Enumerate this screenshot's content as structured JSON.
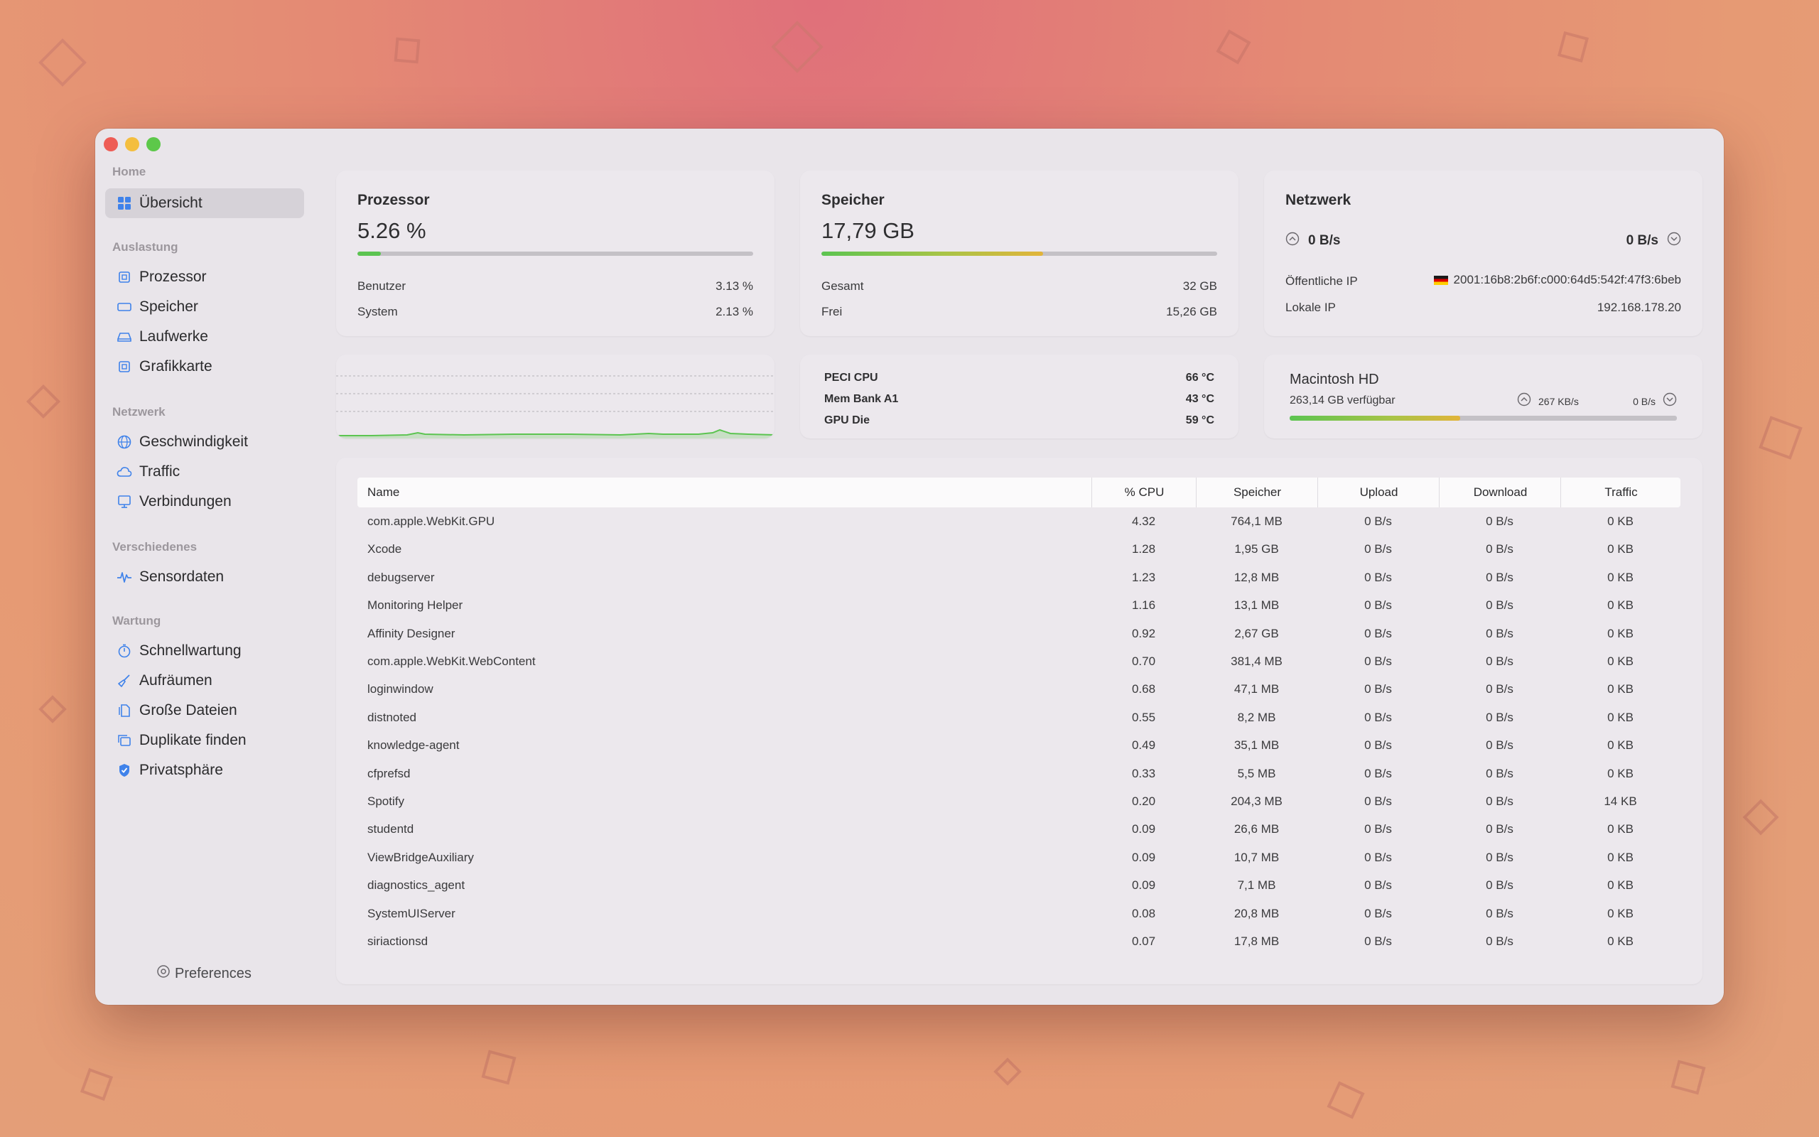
{
  "colors": {
    "accent": "#3f82ea",
    "bar_green": "#5cc451",
    "chart_line": "#5cc451"
  },
  "sidebar": {
    "sections": [
      {
        "title": "Home"
      },
      {
        "title": "Auslastung"
      },
      {
        "title": "Netzwerk"
      },
      {
        "title": "Verschiedenes"
      },
      {
        "title": "Wartung"
      }
    ],
    "items": [
      {
        "label": "Übersicht",
        "icon": "grid-icon"
      },
      {
        "label": "Prozessor",
        "icon": "cpu-icon"
      },
      {
        "label": "Speicher",
        "icon": "memory-icon"
      },
      {
        "label": "Laufwerke",
        "icon": "drive-icon"
      },
      {
        "label": "Grafikkarte",
        "icon": "gpu-icon"
      },
      {
        "label": "Geschwindigkeit",
        "icon": "globe-icon"
      },
      {
        "label": "Traffic",
        "icon": "cloud-icon"
      },
      {
        "label": "Verbindungen",
        "icon": "monitor-icon"
      },
      {
        "label": "Sensordaten",
        "icon": "pulse-icon"
      },
      {
        "label": "Schnellwartung",
        "icon": "stopwatch-icon"
      },
      {
        "label": "Aufräumen",
        "icon": "broom-icon"
      },
      {
        "label": "Große Dateien",
        "icon": "files-icon"
      },
      {
        "label": "Duplikate finden",
        "icon": "duplicate-icon"
      },
      {
        "label": "Privatsphäre",
        "icon": "shield-check-icon"
      }
    ],
    "preferences_label": "Preferences"
  },
  "cpu": {
    "title": "Prozessor",
    "value": "5.26 %",
    "usage_fraction": 0.06,
    "user_label": "Benutzer",
    "user_value": "3.13 %",
    "system_label": "System",
    "system_value": "2.13 %"
  },
  "memory": {
    "title": "Speicher",
    "value": "17,79 GB",
    "usage_fraction": 0.56,
    "total_label": "Gesamt",
    "total_value": "32 GB",
    "free_label": "Frei",
    "free_value": "15,26 GB"
  },
  "network": {
    "title": "Netzwerk",
    "upload": "0 B/s",
    "download": "0 B/s",
    "public_ip_label": "Öffentliche IP",
    "public_ip": "2001:16b8:2b6f:c000:64d5:542f:47f3:6beb",
    "local_ip_label": "Lokale IP",
    "local_ip": "192.168.178.20"
  },
  "sensors": [
    {
      "name": "PECI CPU",
      "value": "66 °C"
    },
    {
      "name": "Mem Bank A1",
      "value": "43 °C"
    },
    {
      "name": "GPU Die",
      "value": "59 °C"
    }
  ],
  "disk": {
    "title": "Macintosh HD",
    "available": "263,14 GB verfügbar",
    "read": "267 KB/s",
    "write": "0 B/s",
    "usage_fraction": 0.44
  },
  "table": {
    "columns": [
      "Name",
      "% CPU",
      "Speicher",
      "Upload",
      "Download",
      "Traffic"
    ],
    "rows": [
      [
        "com.apple.WebKit.GPU",
        "4.32",
        "764,1 MB",
        "0 B/s",
        "0 B/s",
        "0 KB"
      ],
      [
        "Xcode",
        "1.28",
        "1,95 GB",
        "0 B/s",
        "0 B/s",
        "0 KB"
      ],
      [
        "debugserver",
        "1.23",
        "12,8 MB",
        "0 B/s",
        "0 B/s",
        "0 KB"
      ],
      [
        "Monitoring Helper",
        "1.16",
        "13,1 MB",
        "0 B/s",
        "0 B/s",
        "0 KB"
      ],
      [
        "Affinity Designer",
        "0.92",
        "2,67 GB",
        "0 B/s",
        "0 B/s",
        "0 KB"
      ],
      [
        "com.apple.WebKit.WebContent",
        "0.70",
        "381,4 MB",
        "0 B/s",
        "0 B/s",
        "0 KB"
      ],
      [
        "loginwindow",
        "0.68",
        "47,1 MB",
        "0 B/s",
        "0 B/s",
        "0 KB"
      ],
      [
        "distnoted",
        "0.55",
        "8,2 MB",
        "0 B/s",
        "0 B/s",
        "0 KB"
      ],
      [
        "knowledge-agent",
        "0.49",
        "35,1 MB",
        "0 B/s",
        "0 B/s",
        "0 KB"
      ],
      [
        "cfprefsd",
        "0.33",
        "5,5 MB",
        "0 B/s",
        "0 B/s",
        "0 KB"
      ],
      [
        "Spotify",
        "0.20",
        "204,3 MB",
        "0 B/s",
        "0 B/s",
        "14 KB"
      ],
      [
        "studentd",
        "0.09",
        "26,6 MB",
        "0 B/s",
        "0 B/s",
        "0 KB"
      ],
      [
        "ViewBridgeAuxiliary",
        "0.09",
        "10,7 MB",
        "0 B/s",
        "0 B/s",
        "0 KB"
      ],
      [
        "diagnostics_agent",
        "0.09",
        "7,1 MB",
        "0 B/s",
        "0 B/s",
        "0 KB"
      ],
      [
        "SystemUIServer",
        "0.08",
        "20,8 MB",
        "0 B/s",
        "0 B/s",
        "0 KB"
      ],
      [
        "siriactionsd",
        "0.07",
        "17,8 MB",
        "0 B/s",
        "0 B/s",
        "0 KB"
      ]
    ]
  }
}
